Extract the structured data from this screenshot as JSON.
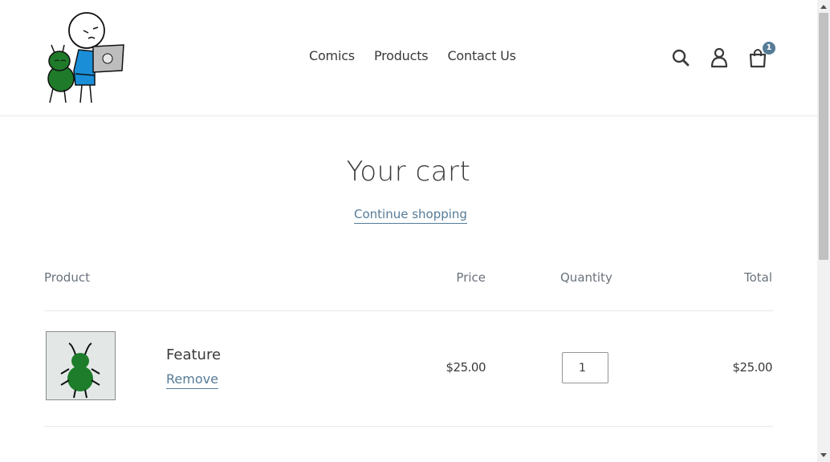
{
  "header": {
    "nav": [
      {
        "label": "Comics"
      },
      {
        "label": "Products"
      },
      {
        "label": "Contact Us"
      }
    ],
    "cart_count": "1",
    "icons": [
      "search-icon",
      "account-icon",
      "cart-icon"
    ]
  },
  "main": {
    "title": "Your cart",
    "continue_label": "Continue shopping",
    "columns": {
      "product": "Product",
      "price": "Price",
      "quantity": "Quantity",
      "total": "Total"
    },
    "items": [
      {
        "name": "Feature",
        "remove_label": "Remove",
        "price": "$25.00",
        "quantity": "1",
        "total": "$25.00"
      }
    ]
  },
  "colors": {
    "accent": "#557b97",
    "text": "#3a3a3a",
    "muted": "#69727b",
    "border": "#e8e8e8"
  }
}
